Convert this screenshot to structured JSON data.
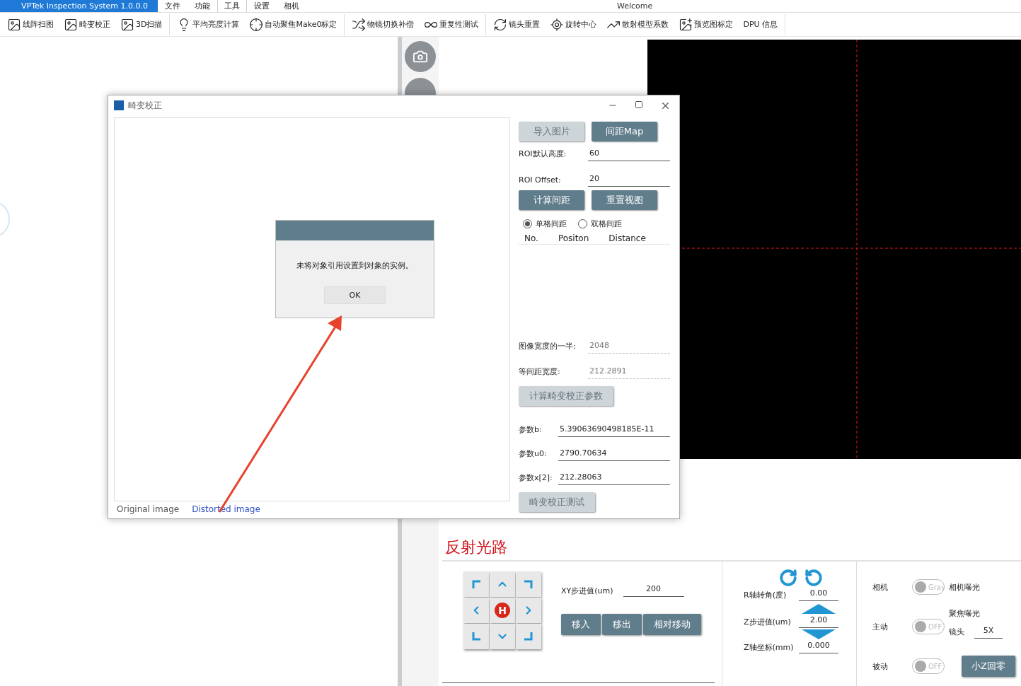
{
  "app": {
    "title": "VPTek Inspection System 1.0.0.0",
    "caption": "Welcome",
    "menu": [
      {
        "label": "文件",
        "selected": false
      },
      {
        "label": "功能",
        "selected": false
      },
      {
        "label": "工具",
        "selected": true
      },
      {
        "label": "设置",
        "selected": false
      },
      {
        "label": "相机",
        "selected": false
      }
    ]
  },
  "toolbar": [
    [
      {
        "label": "线阵扫图",
        "kind": "image"
      },
      {
        "label": "畸变校正",
        "kind": "image"
      },
      {
        "label": "3D扫描",
        "kind": "image"
      }
    ],
    [
      {
        "label": "平均亮度计算",
        "kind": "bulb"
      },
      {
        "label": "自动聚焦Make0标定",
        "kind": "target"
      }
    ],
    [
      {
        "label": "物镜切换补偿",
        "kind": "swap"
      },
      {
        "label": "重复性测试",
        "kind": "loop"
      }
    ],
    [
      {
        "label": "镜头重置",
        "kind": "reset"
      },
      {
        "label": "旋转中心",
        "kind": "rotate"
      },
      {
        "label": "散射模型系数",
        "kind": "curve"
      },
      {
        "label": "预览图标定",
        "kind": "preview"
      },
      {
        "label": "DPU 信息",
        "kind": "text"
      }
    ]
  ],
  "dialog": {
    "title": "畸变校正",
    "top_buttons": [
      {
        "label": "导入图片",
        "disabled": true
      },
      {
        "label": "间距Map",
        "disabled": false
      }
    ],
    "roi_fields": [
      {
        "label": "ROI默认高度:",
        "value": "60"
      },
      {
        "label": "ROI Offset:",
        "value": "20"
      }
    ],
    "calc_buttons": [
      {
        "label": "计算间距",
        "disabled": false
      },
      {
        "label": "重置视图",
        "disabled": false
      }
    ],
    "modes": [
      {
        "label": "单格间距",
        "selected": true
      },
      {
        "label": "双格间距",
        "selected": false
      }
    ],
    "table": {
      "columns": [
        "No.",
        "Positon",
        "Distance"
      ]
    },
    "result_fields": [
      {
        "label": "图像宽度的一半:",
        "value": "2048"
      },
      {
        "label": "等间距宽度:",
        "value": "212.2891"
      }
    ],
    "param_button": {
      "label": "计算畸变校正参数",
      "disabled": true
    },
    "params": [
      {
        "label": "参数b:",
        "value": "5.39063690498185E-11"
      },
      {
        "label": "参数u0:",
        "value": "2790.70634"
      },
      {
        "label": "参数x[2]:",
        "value": "212.28063"
      }
    ],
    "test_button": {
      "label": "畸变校正测试",
      "disabled": true
    },
    "image_tabs": [
      {
        "label": "Original image",
        "selected": false
      },
      {
        "label": "Distorted image",
        "selected": true
      }
    ],
    "message": {
      "text": "未将对象引用设置到对象的实例。",
      "button": "OK"
    }
  },
  "reflect": {
    "title": "反射光路",
    "pad": [
      {
        "kind": "up-left"
      },
      {
        "kind": "up"
      },
      {
        "kind": "up-right"
      },
      {
        "kind": "left"
      },
      {
        "kind": "home",
        "label": "H"
      },
      {
        "kind": "right"
      },
      {
        "kind": "down-left"
      },
      {
        "kind": "down"
      },
      {
        "kind": "down-right"
      }
    ],
    "xy_step": {
      "label": "XY步进值(um)",
      "value": "200"
    },
    "move_buttons": [
      "移入",
      "移出",
      "相对移动"
    ],
    "r_angle": {
      "label": "R轴转角(度)",
      "value": "0.00"
    },
    "z_step": {
      "label": "Z步进值(um)",
      "value": "2.00"
    },
    "z_pos": {
      "label": "Z轴坐标(mm)",
      "value": "0.000"
    },
    "toggles": [
      {
        "label": "相机",
        "text": "Gray",
        "on": false
      },
      {
        "label": "主动",
        "text": "OFF",
        "on": false
      },
      {
        "label": "被动",
        "text": "OFF",
        "on": false
      }
    ],
    "camera_exposure": "相机曝光",
    "focus_exposure": "聚焦曝光",
    "lens": {
      "label": "镜头",
      "value": "5X"
    },
    "zero_button": "小Z回零"
  }
}
